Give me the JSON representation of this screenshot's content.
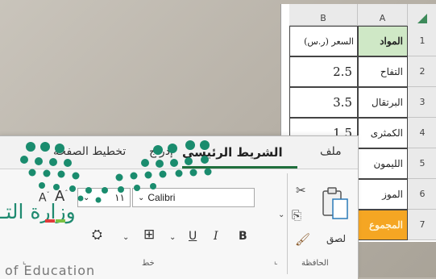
{
  "sheet": {
    "columns": {
      "b": "B",
      "a": "A"
    },
    "rows": [
      {
        "num": "1",
        "a": "المواد",
        "b": "السعر (ر.س)"
      },
      {
        "num": "2",
        "a": "التفاح",
        "b": "2.5"
      },
      {
        "num": "3",
        "a": "البرتقال",
        "b": "3.5"
      },
      {
        "num": "4",
        "a": "الكمثرى",
        "b": "1.5"
      },
      {
        "num": "5",
        "a": "الليمون",
        "b": ""
      },
      {
        "num": "6",
        "a": "الموز",
        "b": ""
      },
      {
        "num": "7",
        "a": "المجموع",
        "b": ""
      }
    ],
    "colors": {
      "header_a": "#cfe8c6",
      "total_a": "#f5a623"
    }
  },
  "ribbon": {
    "tabs": {
      "file": "ملف",
      "home": "الشريط الرئيسي",
      "insert": "إدراج",
      "layout": "تخطيط الصفحة"
    },
    "clipboard": {
      "paste": "لصق",
      "group": "الحافظة"
    },
    "font": {
      "name": "Calibri",
      "size": "١١",
      "group": "خط",
      "bold": "B",
      "italic": "I",
      "underline": "U"
    },
    "accent": "#1f6e3c"
  },
  "logo": {
    "arabic": "وزارة التـ",
    "english": "of Education"
  }
}
